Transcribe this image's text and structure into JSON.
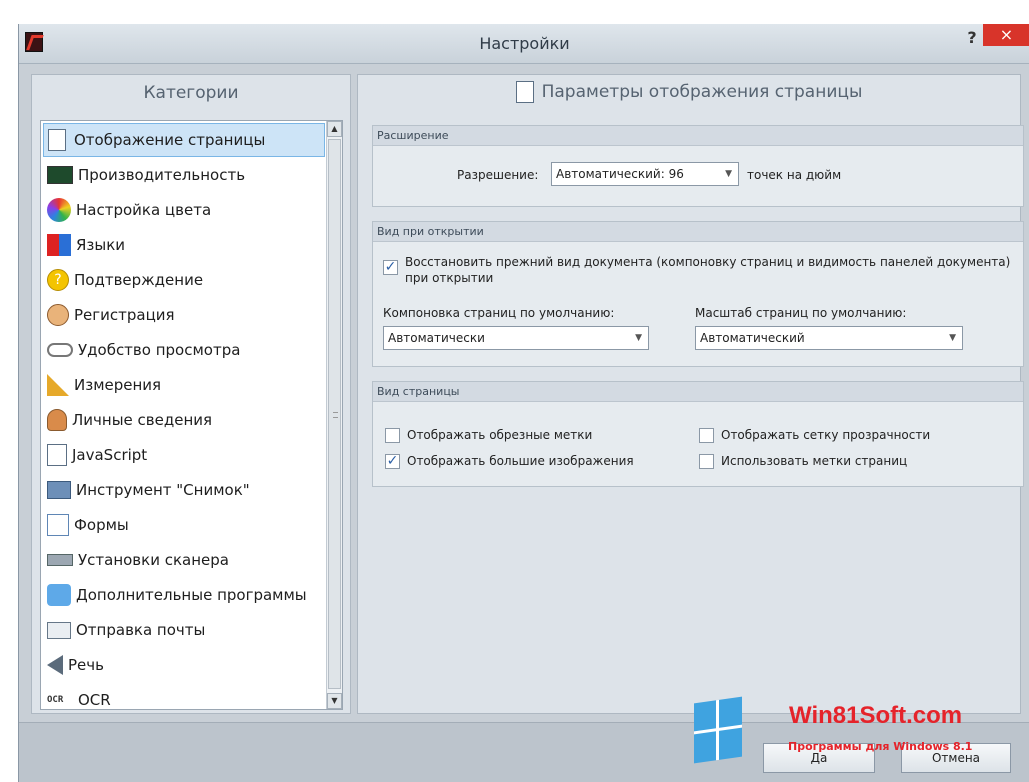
{
  "window": {
    "title": "Настройки",
    "help": "?",
    "close": "×"
  },
  "sidebar": {
    "header": "Категории",
    "items": [
      {
        "label": "Отображение страницы",
        "icon": "page-icon",
        "selected": true
      },
      {
        "label": "Производительность",
        "icon": "performance-icon"
      },
      {
        "label": "Настройка цвета",
        "icon": "color-wheel-icon"
      },
      {
        "label": "Языки",
        "icon": "languages-icon"
      },
      {
        "label": "Подтверждение",
        "icon": "question-icon"
      },
      {
        "label": "Регистрация",
        "icon": "user-registration-icon"
      },
      {
        "label": "Удобство просмотра",
        "icon": "glasses-icon"
      },
      {
        "label": "Измерения",
        "icon": "ruler-icon"
      },
      {
        "label": "Личные сведения",
        "icon": "person-icon"
      },
      {
        "label": "JavaScript",
        "icon": "javascript-icon"
      },
      {
        "label": "Инструмент \"Снимок\"",
        "icon": "camera-icon"
      },
      {
        "label": "Формы",
        "icon": "forms-icon"
      },
      {
        "label": "Установки сканера",
        "icon": "scanner-icon"
      },
      {
        "label": "Дополнительные программы",
        "icon": "addons-icon"
      },
      {
        "label": "Отправка почты",
        "icon": "mail-icon"
      },
      {
        "label": "Речь",
        "icon": "speaker-icon"
      },
      {
        "label": "OCR",
        "icon": "ocr-icon",
        "icon_text": "OCR"
      }
    ]
  },
  "main": {
    "header": "Параметры отображения страницы",
    "groups": {
      "extension": {
        "title": "Расширение",
        "resolution_label": "Разрешение:",
        "resolution_value": "Автоматический: 96",
        "resolution_unit": "точек на дюйм"
      },
      "open_view": {
        "title": "Вид при открытии",
        "restore_checkbox": "Восстановить прежний вид документа (компоновку страниц и видимость панелей документа) при открытии",
        "restore_checked": true,
        "layout_label": "Компоновка страниц по умолчанию:",
        "layout_value": "Автоматически",
        "zoom_label": "Масштаб страниц по умолчанию:",
        "zoom_value": "Автоматический"
      },
      "page_view": {
        "title": "Вид страницы",
        "options": [
          {
            "label": "Отображать обрезные метки",
            "checked": false
          },
          {
            "label": "Отображать сетку прозрачности",
            "checked": false
          },
          {
            "label": "Отображать большие изображения",
            "checked": true
          },
          {
            "label": "Использовать метки страниц",
            "checked": false
          }
        ]
      }
    }
  },
  "footer": {
    "ok": "Да",
    "cancel": "Отмена"
  },
  "watermark": {
    "title": "Win81Soft.com",
    "subtitle": "Программы для Windows 8.1"
  }
}
